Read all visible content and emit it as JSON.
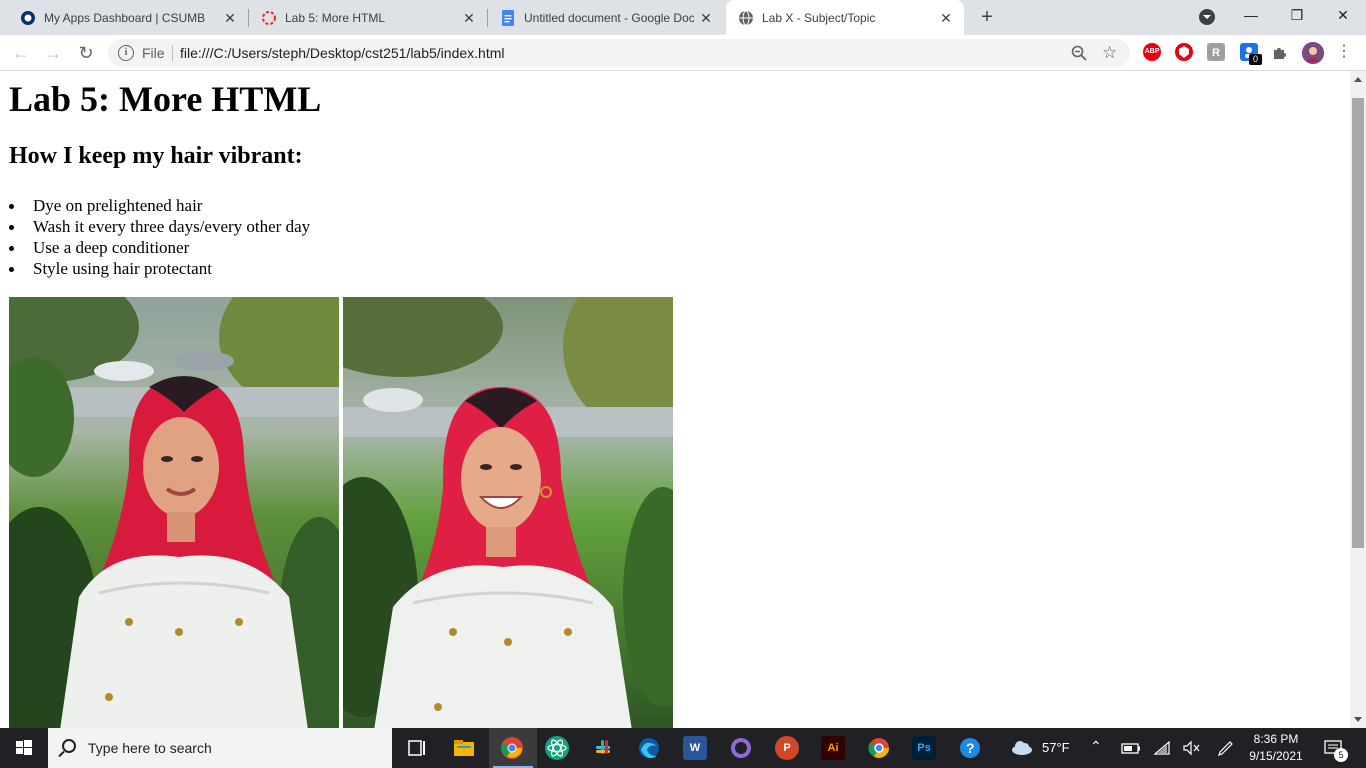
{
  "browser": {
    "tabs": [
      {
        "title": "My Apps Dashboard | CSUMB",
        "icon": "csumb-logo-icon",
        "active": false
      },
      {
        "title": "Lab 5: More HTML",
        "icon": "loading-spinner-icon",
        "active": false
      },
      {
        "title": "Untitled document - Google Doc",
        "icon": "google-docs-icon",
        "active": false
      },
      {
        "title": "Lab X - Subject/Topic",
        "icon": "globe-icon",
        "active": true
      }
    ],
    "omnibox": {
      "protocol_label": "File",
      "url": "file:///C:/Users/steph/Desktop/cst251/lab5/index.html"
    },
    "extensions": {
      "adblock_label": "ABP",
      "badge_count": "0"
    }
  },
  "page": {
    "heading": "Lab 5: More HTML",
    "subheading": "How I keep my hair vibrant:",
    "tips": [
      "Dye on prelightened hair",
      "Wash it every three days/every other day",
      "Use a deep conditioner",
      "Style using hair protectant"
    ]
  },
  "taskbar": {
    "search_placeholder": "Type here to search",
    "apps": {
      "word": "W",
      "powerpoint": "P",
      "illustrator": "Ai",
      "photoshop": "Ps"
    },
    "weather": "57°F",
    "time": "8:36 PM",
    "date": "9/15/2021",
    "notification_count": "5"
  },
  "colors": {
    "tabstrip_bg": "#dee1e6",
    "taskbar_bg": "#202124",
    "hair_red": "#e8274b"
  }
}
